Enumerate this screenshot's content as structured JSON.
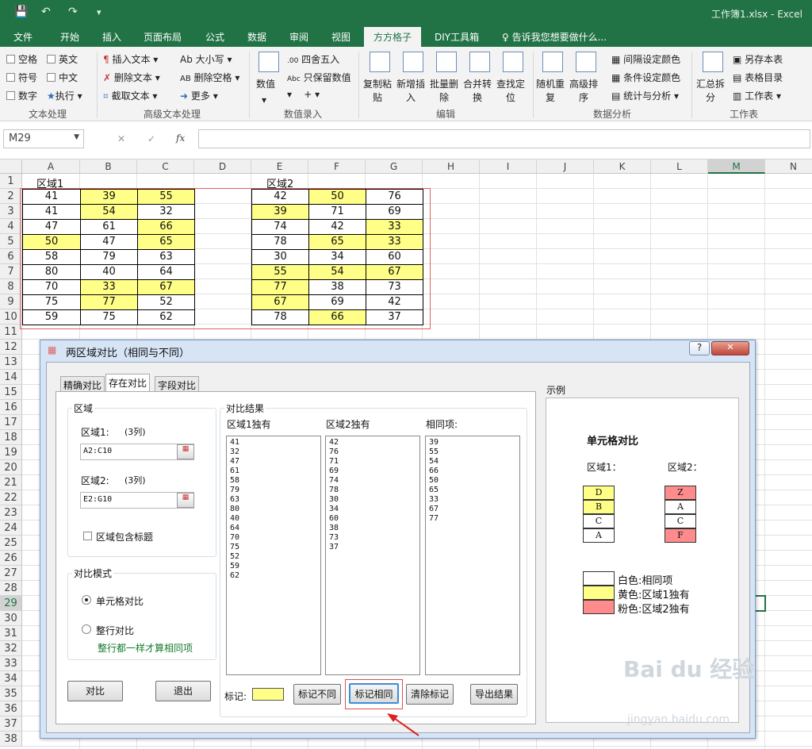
{
  "window": {
    "title": "工作簿1.xlsx - Excel"
  },
  "qat": {
    "save": "💾",
    "undo": "↶",
    "redo": "↷",
    "customize": "▾"
  },
  "tabs": [
    "文件",
    "开始",
    "插入",
    "页面布局",
    "公式",
    "数据",
    "审阅",
    "视图",
    "方方格子",
    "DIY工具箱"
  ],
  "tell_me": "告诉我您想要做什么...",
  "ribbon": {
    "text_proc": {
      "空格": "空格",
      "英文": "英文",
      "符号": "符号",
      "中文": "中文",
      "数字": "数字",
      "执行": "执行",
      "label": "文本处理"
    },
    "adv_text": {
      "插入文本": "插入文本",
      "大小写": "大小写",
      "删除文本": "删除文本",
      "删除空格": "删除空格",
      "截取文本": "截取文本",
      "更多": "更多",
      "label": "高级文本处理"
    },
    "num_entry": {
      "数值": "数值",
      "四舍五入": "四舍五入",
      "只保留数值": "只保留数值",
      "label": "数值录入"
    },
    "edit": {
      "复制粘贴": "复制粘\n贴",
      "新增插入": "新增插\n入",
      "批量删除": "批量删\n除",
      "合并转换": "合并转\n换",
      "查找定位": "查找定\n位",
      "label": "编辑"
    },
    "analysis": {
      "随机重复": "随机重\n复",
      "高级排序": "高级排\n序",
      "间隔设定颜色": "间隔设定颜色",
      "条件设定颜色": "条件设定颜色",
      "统计与分析": "统计与分析",
      "label": "数据分析"
    },
    "worksheet": {
      "汇总拆分": "汇总拆\n分",
      "另存本表": "另存本表",
      "表格目录": "表格目录",
      "工作表": "工作表",
      "label": "工作表"
    }
  },
  "formula_bar": {
    "namebox": "M29",
    "fx": "fx",
    "cancel": "✕",
    "enter": "✓"
  },
  "columns": [
    "A",
    "B",
    "C",
    "D",
    "E",
    "F",
    "G",
    "H",
    "I",
    "J",
    "K",
    "L",
    "M",
    "N"
  ],
  "rows": [
    "1",
    "2",
    "3",
    "4",
    "5",
    "6",
    "7",
    "8",
    "9",
    "10",
    "11",
    "12",
    "13",
    "14",
    "15",
    "16",
    "17",
    "18",
    "19",
    "20",
    "21",
    "22",
    "23",
    "24",
    "25",
    "26",
    "27",
    "28",
    "29",
    "30",
    "31",
    "32",
    "33",
    "34",
    "35",
    "36",
    "37",
    "38"
  ],
  "region1": {
    "label": "区域1",
    "rows": [
      [
        "41",
        "39",
        "55"
      ],
      [
        "41",
        "54",
        "32"
      ],
      [
        "47",
        "61",
        "66"
      ],
      [
        "50",
        "47",
        "65"
      ],
      [
        "58",
        "79",
        "63"
      ],
      [
        "80",
        "40",
        "64"
      ],
      [
        "70",
        "33",
        "67"
      ],
      [
        "75",
        "77",
        "52"
      ],
      [
        "59",
        "75",
        "62"
      ]
    ]
  },
  "region2": {
    "label": "区域2",
    "rows": [
      [
        "42",
        "50",
        "76"
      ],
      [
        "39",
        "71",
        "69"
      ],
      [
        "74",
        "42",
        "33"
      ],
      [
        "78",
        "65",
        "33"
      ],
      [
        "30",
        "34",
        "60"
      ],
      [
        "55",
        "54",
        "67"
      ],
      [
        "77",
        "38",
        "73"
      ],
      [
        "67",
        "69",
        "42"
      ],
      [
        "78",
        "66",
        "37"
      ]
    ]
  },
  "dialog": {
    "title": "两区域对比（相同与不同）",
    "help": "?",
    "close": "✕",
    "tabs": [
      "精确对比",
      "存在对比",
      "字段对比"
    ],
    "region_group": "区域",
    "area1_label": "区域1:",
    "area1_cols": "(3列)",
    "area1_value": "A2:C10",
    "area2_label": "区域2:",
    "area2_cols": "(3列)",
    "area2_value": "E2:G10",
    "include_header": "区域包含标题",
    "mode_group": "对比模式",
    "mode_cell": "单元格对比",
    "mode_row": "整行对比",
    "mode_row_hint": "整行都一样才算相同项",
    "compare_btn": "对比",
    "exit_btn": "退出",
    "result_group": "对比结果",
    "col_r1": "区域1独有",
    "col_r2": "区域2独有",
    "col_same": "相同项:",
    "list_r1": "41\n32\n47\n61\n58\n79\n63\n80\n40\n64\n70\n75\n52\n59\n62",
    "list_r2": "42\n76\n71\n69\n74\n78\n30\n34\n60\n38\n73\n37",
    "list_same": "39\n55\n54\n66\n50\n65\n33\n67\n77",
    "mark_label": "标记:",
    "mark_diff": "标记不同",
    "mark_same": "标记相同",
    "clear_mark": "清除标记",
    "export": "导出结果",
    "example_group": "示例",
    "example_title": "单元格对比",
    "example_r1": "区域1：",
    "example_r2": "区域2：",
    "ex1": [
      "D",
      "B",
      "C",
      "A"
    ],
    "ex2": [
      "Z",
      "A",
      "C",
      "F"
    ],
    "legend_white": "白色:相同项",
    "legend_yellow": "黄色:区域1独有",
    "legend_pink": "粉色:区域2独有"
  },
  "colors": {
    "excel_green": "#217346",
    "yellow": "#ffff88",
    "pink": "#ff8c8c",
    "red_outline": "#d9534f"
  },
  "watermark": {
    "main": "Bai du 经验",
    "sub": "jingyan.baidu.com"
  }
}
